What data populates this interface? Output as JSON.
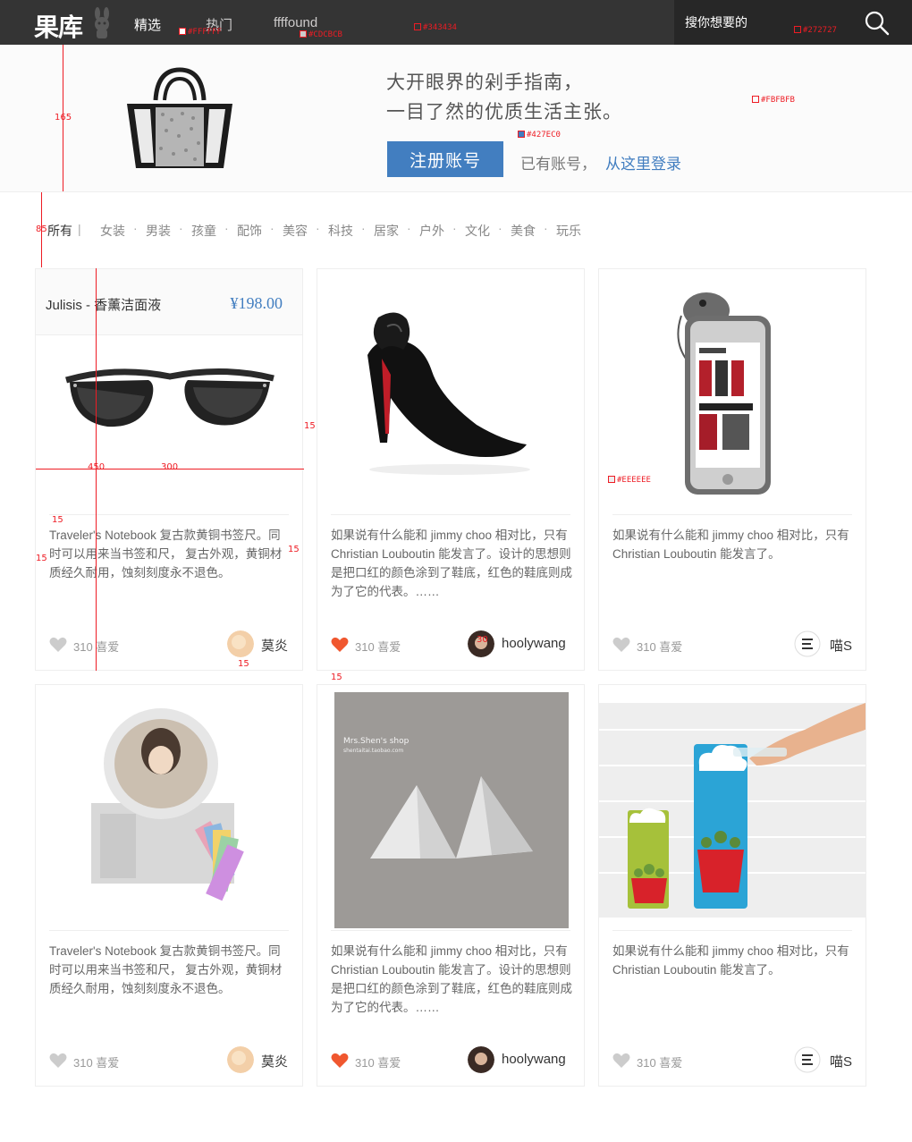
{
  "header": {
    "logo": "果库",
    "nav": [
      "精选",
      "热门",
      "ffffound"
    ],
    "search_placeholder": "搜你想要的"
  },
  "hero": {
    "slogan_line1": "大开眼界的剁手指南，",
    "slogan_line2": "一目了然的优质生活主张。",
    "register_label": "注册账号",
    "have_account": "已有账号，",
    "login_link": "从这里登录"
  },
  "categories": {
    "all": "所有",
    "items": [
      "女装",
      "男装",
      "孩童",
      "配饰",
      "美容",
      "科技",
      "居家",
      "户外",
      "文化",
      "美食",
      "玩乐"
    ]
  },
  "cards": [
    {
      "title": "Julisis - 香薰洁面液",
      "price": "¥198.00",
      "desc": "Traveler's Notebook 复古款黄铜书签尺。同时可以用来当书签和尺， 复古外观，黄铜材质经久耐用，蚀刻刻度永不退色。",
      "likes": "310 喜爱",
      "liked": false,
      "author": "莫炎",
      "image": "sunglasses"
    },
    {
      "desc": "如果说有什么能和 jimmy choo 相对比，只有 Christian Louboutin 能发言了。设计的思想则是把口红的颜色涂到了鞋底，红色的鞋底则成为了它的代表。……",
      "likes": "310 喜爱",
      "liked": true,
      "author": "hoolywang",
      "image": "heels"
    },
    {
      "desc": "如果说有什么能和 jimmy choo 相对比，只有 Christian Louboutin 能发言了。",
      "likes": "310 喜爱",
      "liked": false,
      "author": "喵S",
      "image": "phone"
    },
    {
      "desc": "Traveler's Notebook 复古款黄铜书签尺。同时可以用来当书签和尺， 复古外观，黄铜材质经久耐用，蚀刻刻度永不退色。",
      "likes": "310 喜爱",
      "liked": false,
      "author": "莫炎",
      "image": "cosmetic"
    },
    {
      "desc": "如果说有什么能和 jimmy choo 相对比，只有 Christian Louboutin 能发言了。设计的思想则是把口红的颜色涂到了鞋底，红色的鞋底则成为了它的代表。……",
      "likes": "310 喜爱",
      "liked": true,
      "author": "hoolywang",
      "image": "earrings",
      "image_caption": "Mrs.Shen's shop",
      "image_caption_sub": "shentaitai.taobao.com"
    },
    {
      "desc": "如果说有什么能和 jimmy choo 相对比，只有 Christian Louboutin 能发言了。",
      "likes": "310 喜爱",
      "liked": false,
      "author": "喵S",
      "image": "planters"
    }
  ],
  "annotations": {
    "colors": [
      "#FFFFFF",
      "#CDCBCB",
      "#343434",
      "#272727",
      "#FBFBFB",
      "#427EC0",
      "#EEEEEE"
    ],
    "dims": [
      "165",
      "85",
      "450",
      "300",
      "15",
      "30"
    ]
  },
  "colors": {
    "topbar": "#343434",
    "search_bg": "#272727",
    "hero_bg": "#fbfbfb",
    "accent": "#427ec0",
    "border": "#eeeeee",
    "like_active": "#f0572f"
  }
}
